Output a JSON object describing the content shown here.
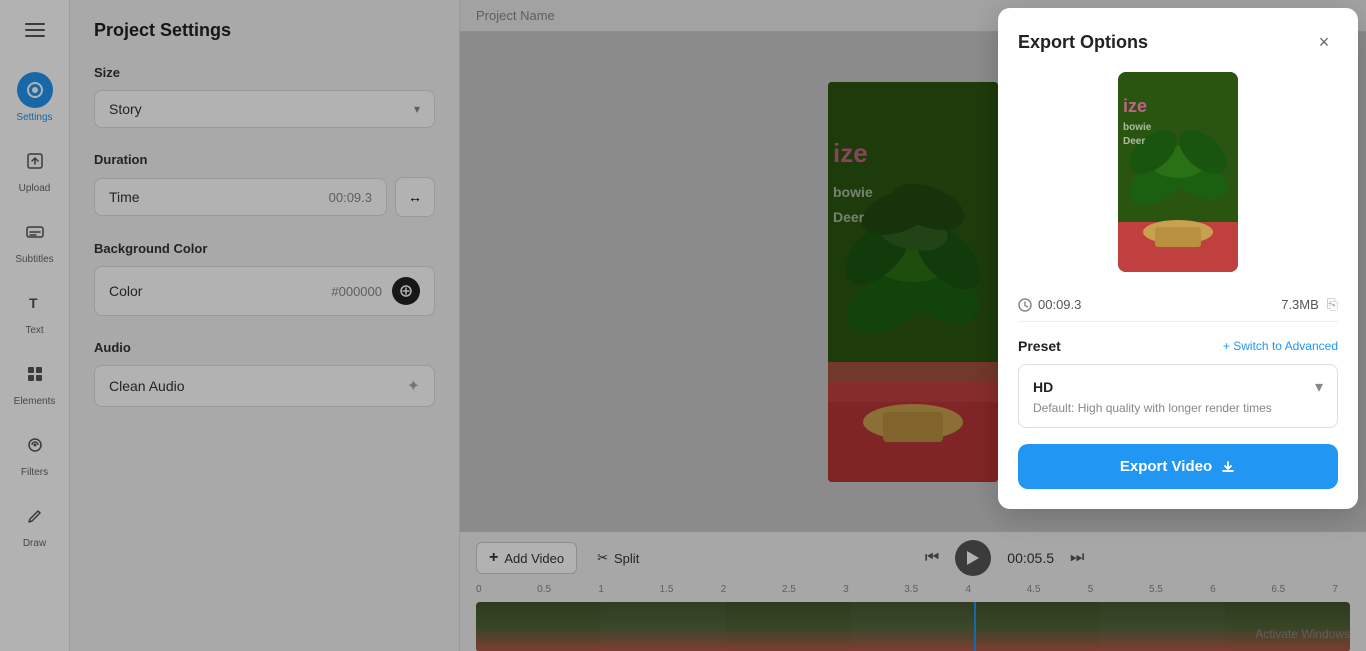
{
  "sidebar": {
    "menu_icon": "☰",
    "items": [
      {
        "id": "settings",
        "label": "Settings",
        "active": true
      },
      {
        "id": "upload",
        "label": "Upload",
        "active": false
      },
      {
        "id": "subtitles",
        "label": "Subtitles",
        "active": false
      },
      {
        "id": "text",
        "label": "Text",
        "active": false
      },
      {
        "id": "elements",
        "label": "Elements",
        "active": false
      },
      {
        "id": "filters",
        "label": "Filters",
        "active": false
      },
      {
        "id": "draw",
        "label": "Draw",
        "active": false
      }
    ]
  },
  "settings": {
    "title": "Project Settings",
    "size": {
      "label": "Size",
      "value": "Story"
    },
    "duration": {
      "label": "Duration",
      "field_label": "Time",
      "value": "00:09.3"
    },
    "background_color": {
      "label": "Background Color",
      "field_label": "Color",
      "hex": "#000000"
    },
    "audio": {
      "label": "Audio",
      "value": "Clean Audio"
    }
  },
  "canvas": {
    "project_name": "Project Name"
  },
  "timeline": {
    "add_video_label": "Add Video",
    "split_label": "Split",
    "timecode": "00:05.5",
    "ruler_marks": [
      "0",
      "0.5",
      "1",
      "1.5",
      "2",
      "2.5",
      "3",
      "3.5",
      "4",
      "4.5",
      "5",
      "5.5",
      "6",
      "6.5",
      "7"
    ]
  },
  "export_modal": {
    "title": "Export Options",
    "close_label": "×",
    "duration": "00:09.3",
    "filesize": "7.3MB",
    "preset": {
      "label": "Preset",
      "switch_label": "+ Switch to Advanced",
      "name": "HD",
      "description": "Default: High quality with longer render times"
    },
    "export_btn_label": "Export Video"
  },
  "activate_windows": "Activate Windows"
}
